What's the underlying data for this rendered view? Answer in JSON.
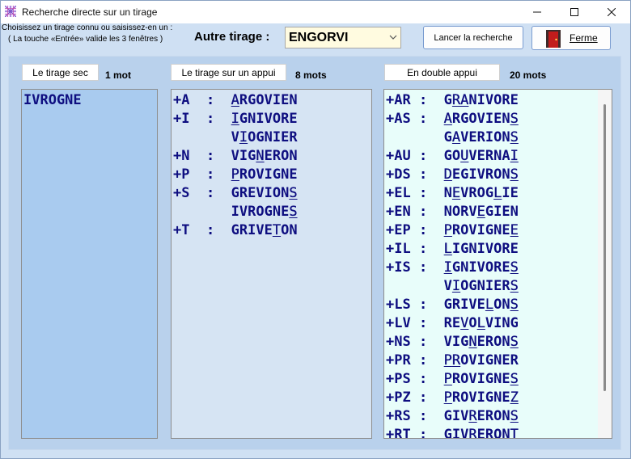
{
  "window": {
    "title": "Recherche directe sur un tirage"
  },
  "instructions": {
    "line1": "Choisissez un tirage connu ou saisissez-en un :",
    "line2": "( La touche «Entrée» valide les 3 fenêtres )"
  },
  "autre": {
    "label": "Autre tirage :",
    "value": "ENGORVI"
  },
  "buttons": {
    "search": "Lancer la recherche",
    "close": "Ferme"
  },
  "sections": {
    "sec": {
      "label": "Le tirage sec",
      "count": "1 mot"
    },
    "appui": {
      "label": "Le tirage sur un appui",
      "count": "8 mots"
    },
    "double": {
      "label": "En double appui",
      "count": "20 mots"
    }
  },
  "lists": {
    "sec": [
      {
        "prefix": "",
        "parts": [
          {
            "t": "IVROGNE",
            "u": false
          }
        ]
      }
    ],
    "appui": [
      {
        "prefix": "+A  :  ",
        "parts": [
          {
            "t": "A",
            "u": true
          },
          {
            "t": "RGOVIEN",
            "u": false
          }
        ]
      },
      {
        "prefix": "+I  :  ",
        "parts": [
          {
            "t": "I",
            "u": true
          },
          {
            "t": "GNIVORE",
            "u": false
          }
        ]
      },
      {
        "prefix": "       ",
        "parts": [
          {
            "t": "V",
            "u": false
          },
          {
            "t": "I",
            "u": true
          },
          {
            "t": "OGNIER",
            "u": false
          }
        ]
      },
      {
        "prefix": "+N  :  ",
        "parts": [
          {
            "t": "VIG",
            "u": false
          },
          {
            "t": "N",
            "u": true
          },
          {
            "t": "ERON",
            "u": false
          }
        ]
      },
      {
        "prefix": "+P  :  ",
        "parts": [
          {
            "t": "P",
            "u": true
          },
          {
            "t": "ROVIGNE",
            "u": false
          }
        ]
      },
      {
        "prefix": "+S  :  ",
        "parts": [
          {
            "t": "GREVION",
            "u": false
          },
          {
            "t": "S",
            "u": true
          }
        ]
      },
      {
        "prefix": "       ",
        "parts": [
          {
            "t": "IVROGNE",
            "u": false
          },
          {
            "t": "S",
            "u": true
          }
        ]
      },
      {
        "prefix": "+T  :  ",
        "parts": [
          {
            "t": "GRIVE",
            "u": false
          },
          {
            "t": "T",
            "u": true
          },
          {
            "t": "ON",
            "u": false
          }
        ]
      }
    ],
    "double": [
      {
        "prefix": "+AR :  ",
        "parts": [
          {
            "t": "G",
            "u": false
          },
          {
            "t": "RA",
            "u": true
          },
          {
            "t": "NIVORE",
            "u": false
          }
        ]
      },
      {
        "prefix": "+AS :  ",
        "parts": [
          {
            "t": "A",
            "u": true
          },
          {
            "t": "RGOVIEN",
            "u": false
          },
          {
            "t": "S",
            "u": true
          }
        ]
      },
      {
        "prefix": "       ",
        "parts": [
          {
            "t": "G",
            "u": false
          },
          {
            "t": "A",
            "u": true
          },
          {
            "t": "VERION",
            "u": false
          },
          {
            "t": "S",
            "u": true
          }
        ]
      },
      {
        "prefix": "+AU :  ",
        "parts": [
          {
            "t": "GO",
            "u": false
          },
          {
            "t": "U",
            "u": true
          },
          {
            "t": "VERNA",
            "u": false
          },
          {
            "t": "I",
            "u": true
          }
        ]
      },
      {
        "prefix": "+DS :  ",
        "parts": [
          {
            "t": "D",
            "u": true
          },
          {
            "t": "EGIVRON",
            "u": false
          },
          {
            "t": "S",
            "u": true
          }
        ]
      },
      {
        "prefix": "+EL :  ",
        "parts": [
          {
            "t": "N",
            "u": false
          },
          {
            "t": "E",
            "u": true
          },
          {
            "t": "VROG",
            "u": false
          },
          {
            "t": "L",
            "u": true
          },
          {
            "t": "IE",
            "u": false
          }
        ]
      },
      {
        "prefix": "+EN :  ",
        "parts": [
          {
            "t": "NORV",
            "u": false
          },
          {
            "t": "E",
            "u": true
          },
          {
            "t": "GIEN",
            "u": false
          }
        ]
      },
      {
        "prefix": "+EP :  ",
        "parts": [
          {
            "t": "P",
            "u": true
          },
          {
            "t": "ROVIGNE",
            "u": false
          },
          {
            "t": "E",
            "u": true
          }
        ]
      },
      {
        "prefix": "+IL :  ",
        "parts": [
          {
            "t": "L",
            "u": true
          },
          {
            "t": "I",
            "u": false
          },
          {
            "t": "GNIVORE",
            "u": false
          }
        ]
      },
      {
        "prefix": "+IS :  ",
        "parts": [
          {
            "t": "I",
            "u": true
          },
          {
            "t": "GNIVORE",
            "u": false
          },
          {
            "t": "S",
            "u": true
          }
        ]
      },
      {
        "prefix": "       ",
        "parts": [
          {
            "t": "V",
            "u": false
          },
          {
            "t": "I",
            "u": true
          },
          {
            "t": "OGNIER",
            "u": false
          },
          {
            "t": "S",
            "u": true
          }
        ]
      },
      {
        "prefix": "+LS :  ",
        "parts": [
          {
            "t": "GRIVE",
            "u": false
          },
          {
            "t": "L",
            "u": true
          },
          {
            "t": "ON",
            "u": false
          },
          {
            "t": "S",
            "u": true
          }
        ]
      },
      {
        "prefix": "+LV :  ",
        "parts": [
          {
            "t": "RE",
            "u": false
          },
          {
            "t": "V",
            "u": true
          },
          {
            "t": "O",
            "u": false
          },
          {
            "t": "L",
            "u": true
          },
          {
            "t": "VING",
            "u": false
          }
        ]
      },
      {
        "prefix": "+NS :  ",
        "parts": [
          {
            "t": "VIG",
            "u": false
          },
          {
            "t": "N",
            "u": true
          },
          {
            "t": "ERON",
            "u": false
          },
          {
            "t": "S",
            "u": true
          }
        ]
      },
      {
        "prefix": "+PR :  ",
        "parts": [
          {
            "t": "P",
            "u": true
          },
          {
            "t": "R",
            "u": true
          },
          {
            "t": "OVIGNER",
            "u": false
          }
        ]
      },
      {
        "prefix": "+PS :  ",
        "parts": [
          {
            "t": "P",
            "u": true
          },
          {
            "t": "ROVIGNE",
            "u": false
          },
          {
            "t": "S",
            "u": true
          }
        ]
      },
      {
        "prefix": "+PZ :  ",
        "parts": [
          {
            "t": "P",
            "u": true
          },
          {
            "t": "ROVIGNE",
            "u": false
          },
          {
            "t": "Z",
            "u": true
          }
        ]
      },
      {
        "prefix": "+RS :  ",
        "parts": [
          {
            "t": "GIV",
            "u": false
          },
          {
            "t": "R",
            "u": true
          },
          {
            "t": "ERON",
            "u": false
          },
          {
            "t": "S",
            "u": true
          }
        ]
      },
      {
        "prefix": "+RT :  ",
        "parts": [
          {
            "t": "GIV",
            "u": false
          },
          {
            "t": "R",
            "u": true
          },
          {
            "t": "ERON",
            "u": false
          },
          {
            "t": "T",
            "u": true
          }
        ]
      }
    ]
  },
  "icons": {
    "app": "grid-pattern-icon",
    "combo_arrow": "chevron-down-icon",
    "close": "door-icon"
  }
}
